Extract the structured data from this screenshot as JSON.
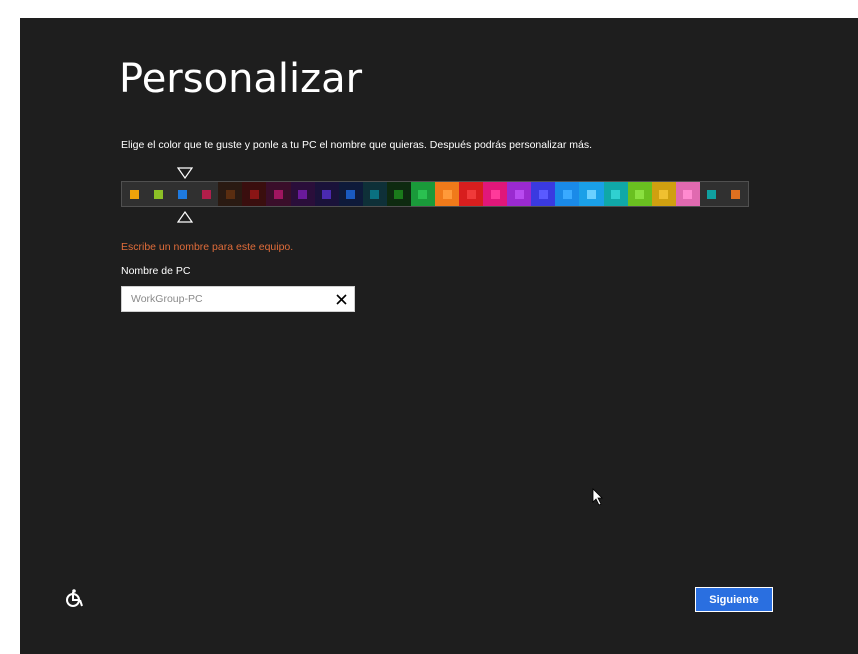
{
  "setup": {
    "title": "Personalizar",
    "description": "Elige el color que te guste y ponle a tu PC el nombre que quieras. Después podrás personalizar más.",
    "colors": [
      {
        "bg": "#303030",
        "swatch": "#f0a30a"
      },
      {
        "bg": "#303030",
        "swatch": "#8cbf26"
      },
      {
        "bg": "#303030",
        "swatch": "#1e7ae0"
      },
      {
        "bg": "#303030",
        "swatch": "#b01e4a"
      },
      {
        "bg": "#2a1a12",
        "swatch": "#5a2d10"
      },
      {
        "bg": "#3a0e0e",
        "swatch": "#8a1515"
      },
      {
        "bg": "#3a0e2a",
        "swatch": "#a01560"
      },
      {
        "bg": "#2a0e3a",
        "swatch": "#6a1a9a"
      },
      {
        "bg": "#1a123a",
        "swatch": "#4a2ab0"
      },
      {
        "bg": "#0e1a3a",
        "swatch": "#1a5ac0"
      },
      {
        "bg": "#0e3038",
        "swatch": "#0a7080"
      },
      {
        "bg": "#0e2a10",
        "swatch": "#1a7a1a"
      },
      {
        "bg": "#1a9a3a",
        "swatch": "#2ac050"
      },
      {
        "bg": "#f07a1a",
        "swatch": "#ff9a3a"
      },
      {
        "bg": "#d81e1e",
        "swatch": "#f03a3a"
      },
      {
        "bg": "#e0177a",
        "swatch": "#ff3a9a"
      },
      {
        "bg": "#9a2ad0",
        "swatch": "#b84af0"
      },
      {
        "bg": "#3a3ae0",
        "swatch": "#5a5aff"
      },
      {
        "bg": "#1a8ae8",
        "swatch": "#3aaaff"
      },
      {
        "bg": "#1aa0e8",
        "swatch": "#6ad0ff"
      },
      {
        "bg": "#10a8a8",
        "swatch": "#30d0d0"
      },
      {
        "bg": "#6ac020",
        "swatch": "#8ae040"
      },
      {
        "bg": "#d0a010",
        "swatch": "#f0c030"
      },
      {
        "bg": "#e06ab0",
        "swatch": "#ff8ad0"
      },
      {
        "bg": "#303030",
        "swatch": "#10a0a0"
      },
      {
        "bg": "#303030",
        "swatch": "#e07020"
      }
    ],
    "selected_color_index": 2,
    "error_message": "Escribe un nombre para este equipo.",
    "pc_name_label": "Nombre de PC",
    "pc_name_value": "WorkGroup-PC",
    "next_button": "Siguiente",
    "ease_of_access_icon": "ease-of-access-icon",
    "clear_icon": "close-icon"
  }
}
